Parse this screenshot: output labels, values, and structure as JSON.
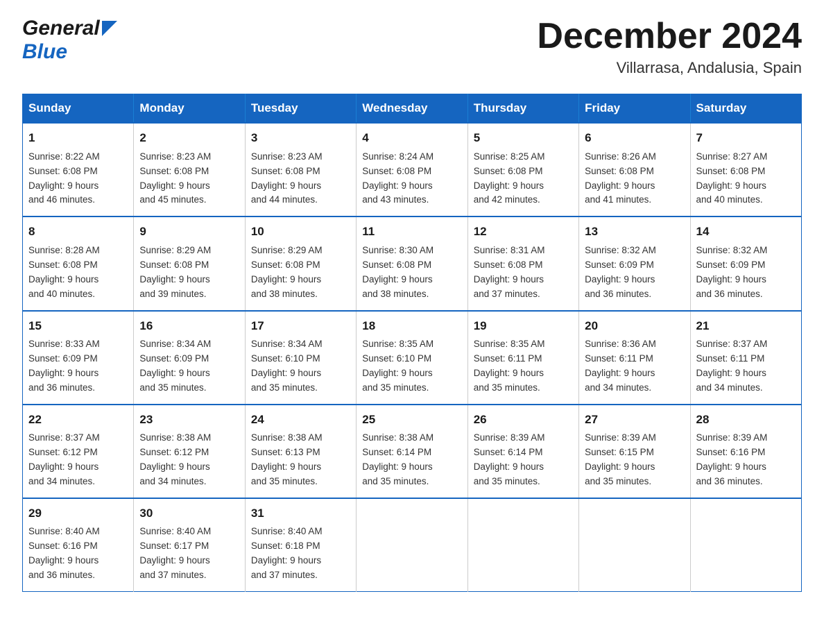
{
  "header": {
    "logo_general": "General",
    "logo_blue": "Blue",
    "title": "December 2024",
    "subtitle": "Villarrasa, Andalusia, Spain"
  },
  "calendar": {
    "days_of_week": [
      "Sunday",
      "Monday",
      "Tuesday",
      "Wednesday",
      "Thursday",
      "Friday",
      "Saturday"
    ],
    "weeks": [
      [
        {
          "day": "1",
          "info": "Sunrise: 8:22 AM\nSunset: 6:08 PM\nDaylight: 9 hours\nand 46 minutes."
        },
        {
          "day": "2",
          "info": "Sunrise: 8:23 AM\nSunset: 6:08 PM\nDaylight: 9 hours\nand 45 minutes."
        },
        {
          "day": "3",
          "info": "Sunrise: 8:23 AM\nSunset: 6:08 PM\nDaylight: 9 hours\nand 44 minutes."
        },
        {
          "day": "4",
          "info": "Sunrise: 8:24 AM\nSunset: 6:08 PM\nDaylight: 9 hours\nand 43 minutes."
        },
        {
          "day": "5",
          "info": "Sunrise: 8:25 AM\nSunset: 6:08 PM\nDaylight: 9 hours\nand 42 minutes."
        },
        {
          "day": "6",
          "info": "Sunrise: 8:26 AM\nSunset: 6:08 PM\nDaylight: 9 hours\nand 41 minutes."
        },
        {
          "day": "7",
          "info": "Sunrise: 8:27 AM\nSunset: 6:08 PM\nDaylight: 9 hours\nand 40 minutes."
        }
      ],
      [
        {
          "day": "8",
          "info": "Sunrise: 8:28 AM\nSunset: 6:08 PM\nDaylight: 9 hours\nand 40 minutes."
        },
        {
          "day": "9",
          "info": "Sunrise: 8:29 AM\nSunset: 6:08 PM\nDaylight: 9 hours\nand 39 minutes."
        },
        {
          "day": "10",
          "info": "Sunrise: 8:29 AM\nSunset: 6:08 PM\nDaylight: 9 hours\nand 38 minutes."
        },
        {
          "day": "11",
          "info": "Sunrise: 8:30 AM\nSunset: 6:08 PM\nDaylight: 9 hours\nand 38 minutes."
        },
        {
          "day": "12",
          "info": "Sunrise: 8:31 AM\nSunset: 6:08 PM\nDaylight: 9 hours\nand 37 minutes."
        },
        {
          "day": "13",
          "info": "Sunrise: 8:32 AM\nSunset: 6:09 PM\nDaylight: 9 hours\nand 36 minutes."
        },
        {
          "day": "14",
          "info": "Sunrise: 8:32 AM\nSunset: 6:09 PM\nDaylight: 9 hours\nand 36 minutes."
        }
      ],
      [
        {
          "day": "15",
          "info": "Sunrise: 8:33 AM\nSunset: 6:09 PM\nDaylight: 9 hours\nand 36 minutes."
        },
        {
          "day": "16",
          "info": "Sunrise: 8:34 AM\nSunset: 6:09 PM\nDaylight: 9 hours\nand 35 minutes."
        },
        {
          "day": "17",
          "info": "Sunrise: 8:34 AM\nSunset: 6:10 PM\nDaylight: 9 hours\nand 35 minutes."
        },
        {
          "day": "18",
          "info": "Sunrise: 8:35 AM\nSunset: 6:10 PM\nDaylight: 9 hours\nand 35 minutes."
        },
        {
          "day": "19",
          "info": "Sunrise: 8:35 AM\nSunset: 6:11 PM\nDaylight: 9 hours\nand 35 minutes."
        },
        {
          "day": "20",
          "info": "Sunrise: 8:36 AM\nSunset: 6:11 PM\nDaylight: 9 hours\nand 34 minutes."
        },
        {
          "day": "21",
          "info": "Sunrise: 8:37 AM\nSunset: 6:11 PM\nDaylight: 9 hours\nand 34 minutes."
        }
      ],
      [
        {
          "day": "22",
          "info": "Sunrise: 8:37 AM\nSunset: 6:12 PM\nDaylight: 9 hours\nand 34 minutes."
        },
        {
          "day": "23",
          "info": "Sunrise: 8:38 AM\nSunset: 6:12 PM\nDaylight: 9 hours\nand 34 minutes."
        },
        {
          "day": "24",
          "info": "Sunrise: 8:38 AM\nSunset: 6:13 PM\nDaylight: 9 hours\nand 35 minutes."
        },
        {
          "day": "25",
          "info": "Sunrise: 8:38 AM\nSunset: 6:14 PM\nDaylight: 9 hours\nand 35 minutes."
        },
        {
          "day": "26",
          "info": "Sunrise: 8:39 AM\nSunset: 6:14 PM\nDaylight: 9 hours\nand 35 minutes."
        },
        {
          "day": "27",
          "info": "Sunrise: 8:39 AM\nSunset: 6:15 PM\nDaylight: 9 hours\nand 35 minutes."
        },
        {
          "day": "28",
          "info": "Sunrise: 8:39 AM\nSunset: 6:16 PM\nDaylight: 9 hours\nand 36 minutes."
        }
      ],
      [
        {
          "day": "29",
          "info": "Sunrise: 8:40 AM\nSunset: 6:16 PM\nDaylight: 9 hours\nand 36 minutes."
        },
        {
          "day": "30",
          "info": "Sunrise: 8:40 AM\nSunset: 6:17 PM\nDaylight: 9 hours\nand 37 minutes."
        },
        {
          "day": "31",
          "info": "Sunrise: 8:40 AM\nSunset: 6:18 PM\nDaylight: 9 hours\nand 37 minutes."
        },
        {
          "day": "",
          "info": ""
        },
        {
          "day": "",
          "info": ""
        },
        {
          "day": "",
          "info": ""
        },
        {
          "day": "",
          "info": ""
        }
      ]
    ]
  }
}
